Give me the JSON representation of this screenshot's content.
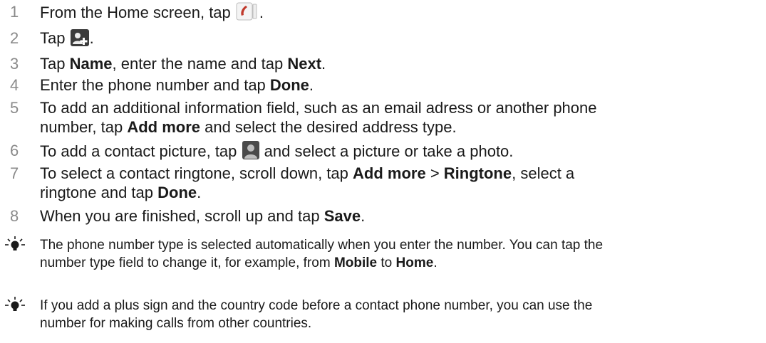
{
  "steps": [
    {
      "num": "1",
      "a": "From the Home screen, tap ",
      "b": "."
    },
    {
      "num": "2",
      "a": "Tap ",
      "b": "."
    },
    {
      "num": "3",
      "a": "Tap ",
      "bold1": "Name",
      "b": ", enter the name and tap ",
      "bold2": "Next",
      "c": "."
    },
    {
      "num": "4",
      "a": "Enter the phone number and tap ",
      "bold1": "Done",
      "b": "."
    },
    {
      "num": "5",
      "line1": "To add an additional information field, such as an email adress or another phone",
      "a": "number, tap ",
      "bold1": "Add more",
      "b": " and select the desired address type."
    },
    {
      "num": "6",
      "a": "To add a contact picture, tap ",
      "b": " and select a picture or take a photo."
    },
    {
      "num": "7",
      "a": "To select a contact ringtone, scroll down, tap ",
      "bold1": "Add more",
      "b": " > ",
      "bold2": "Ringtone",
      "c": ", select a",
      "line2a": "ringtone and tap ",
      "line2bold": "Done",
      "line2b": "."
    },
    {
      "num": "8",
      "a": "When you are finished, scroll up and tap ",
      "bold1": "Save",
      "b": "."
    }
  ],
  "notes": [
    {
      "line1": "The phone number type is selected automatically when you enter the number. You can tap the",
      "a": "number type field to change it, for example, from ",
      "bold1": "Mobile",
      "b": " to ",
      "bold2": "Home",
      "c": "."
    },
    {
      "line1": "If you add a plus sign and the country code before a contact phone number, you can use the",
      "line2": "number for making calls from other countries."
    }
  ],
  "icons": {
    "phone": "phone-app-icon",
    "add_contact": "add-contact-icon",
    "contact_picture": "contact-picture-icon",
    "tip": "lightbulb-tip-icon"
  },
  "colors": {
    "text": "#1a1a1a",
    "step_number": "#8a8a8a",
    "phone_icon_red": "#c0392b"
  }
}
